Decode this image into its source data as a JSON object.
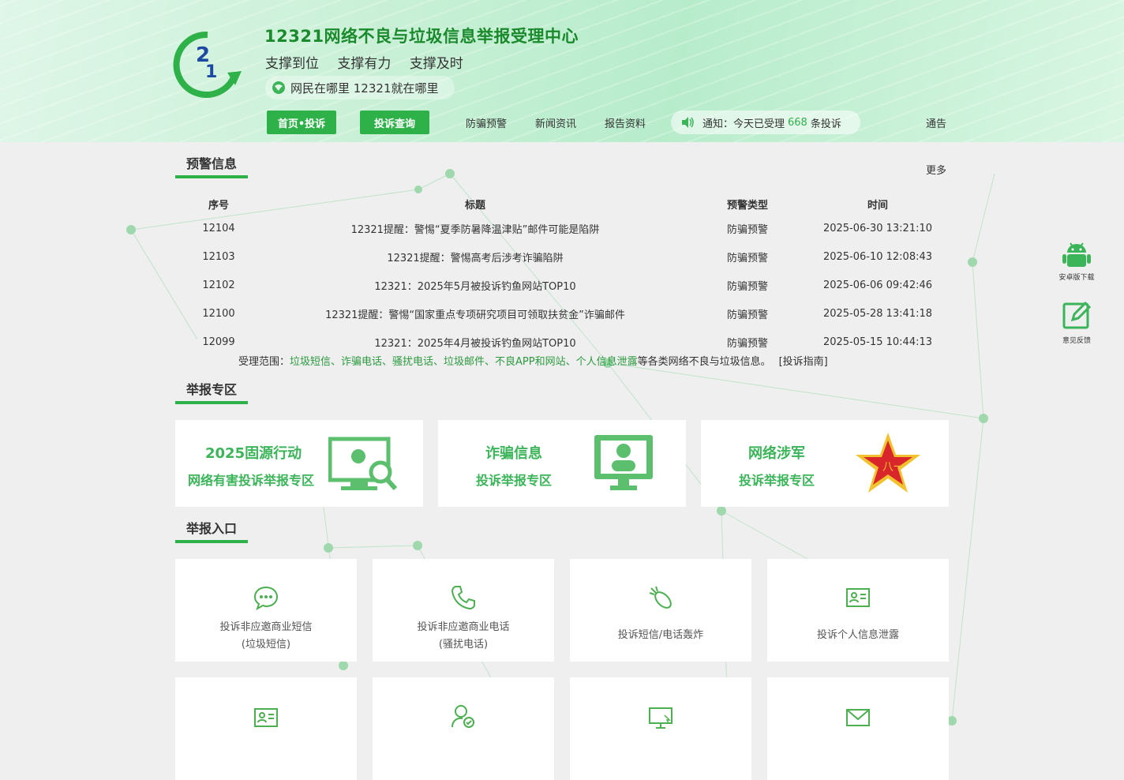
{
  "header": {
    "site_title": "12321网络不良与垃圾信息举报受理中心",
    "slogans": [
      "支撑到位",
      "支撑有力",
      "支撑及时"
    ],
    "motto": "网民在哪里 12321就在哪里"
  },
  "nav": {
    "home": "首页•投诉",
    "query": "投诉查询",
    "links": [
      "防骗预警",
      "新闻资讯",
      "报告资料"
    ],
    "notice_prefix": "通知：今天已受理",
    "notice_count": "668",
    "notice_suffix": "条投诉",
    "announcement": "通告"
  },
  "warning": {
    "section_title": "预警信息",
    "more": "更多",
    "columns": [
      "序号",
      "标题",
      "预警类型",
      "时间"
    ],
    "rows": [
      [
        "12104",
        "12321提醒：警惕“夏季防暑降温津贴”邮件可能是陷阱",
        "防骗预警",
        "2025-06-30 13:21:10"
      ],
      [
        "12103",
        "12321提醒：警惕高考后涉考诈骗陷阱",
        "防骗预警",
        "2025-06-10 12:08:43"
      ],
      [
        "12102",
        "12321：2025年5月被投诉钓鱼网站TOP10",
        "防骗预警",
        "2025-06-06 09:42:46"
      ],
      [
        "12100",
        "12321提醒：警惕“国家重点专项研究项目可领取扶贫金”诈骗邮件",
        "防骗预警",
        "2025-05-28 13:41:18"
      ],
      [
        "12099",
        "12321：2025年4月被投诉钓鱼网站TOP10",
        "防骗预警",
        "2025-05-15 10:44:13"
      ]
    ],
    "scope_prefix": "受理范围：",
    "scope_items": "垃圾短信、诈骗电话、骚扰电话、垃圾邮件、不良APP和网站、个人信息泄露",
    "scope_suffix": "等各类网络不良与垃圾信息。",
    "guide": "[投诉指南]"
  },
  "zones": {
    "section_title": "举报专区",
    "cards": [
      {
        "line1": "2025固源行动",
        "line2": "网络有害投诉举报专区"
      },
      {
        "line1": "诈骗信息",
        "line2": "投诉举报专区"
      },
      {
        "line1": "网络涉军",
        "line2": "投诉举报专区"
      }
    ]
  },
  "entries": {
    "section_title": "举报入口",
    "items": [
      {
        "line1": "投诉非应邀商业短信",
        "line2": "(垃圾短信)",
        "icon": "sms-icon"
      },
      {
        "line1": "投诉非应邀商业电话",
        "line2": "(骚扰电话)",
        "icon": "phone-icon"
      },
      {
        "line1": "投诉短信/电话轰炸",
        "line2": "",
        "icon": "bomb-icon"
      },
      {
        "line1": "投诉个人信息泄露",
        "line2": "",
        "icon": "id-card-icon"
      }
    ],
    "row2_icons": [
      "id-card-icon",
      "user-check-icon",
      "monitor-icon",
      "mail-icon"
    ]
  },
  "side": {
    "android": "安卓版下载",
    "feedback": "意见反馈"
  },
  "colors": {
    "accent": "#2fb14a",
    "card_text": "#3cb55a"
  }
}
